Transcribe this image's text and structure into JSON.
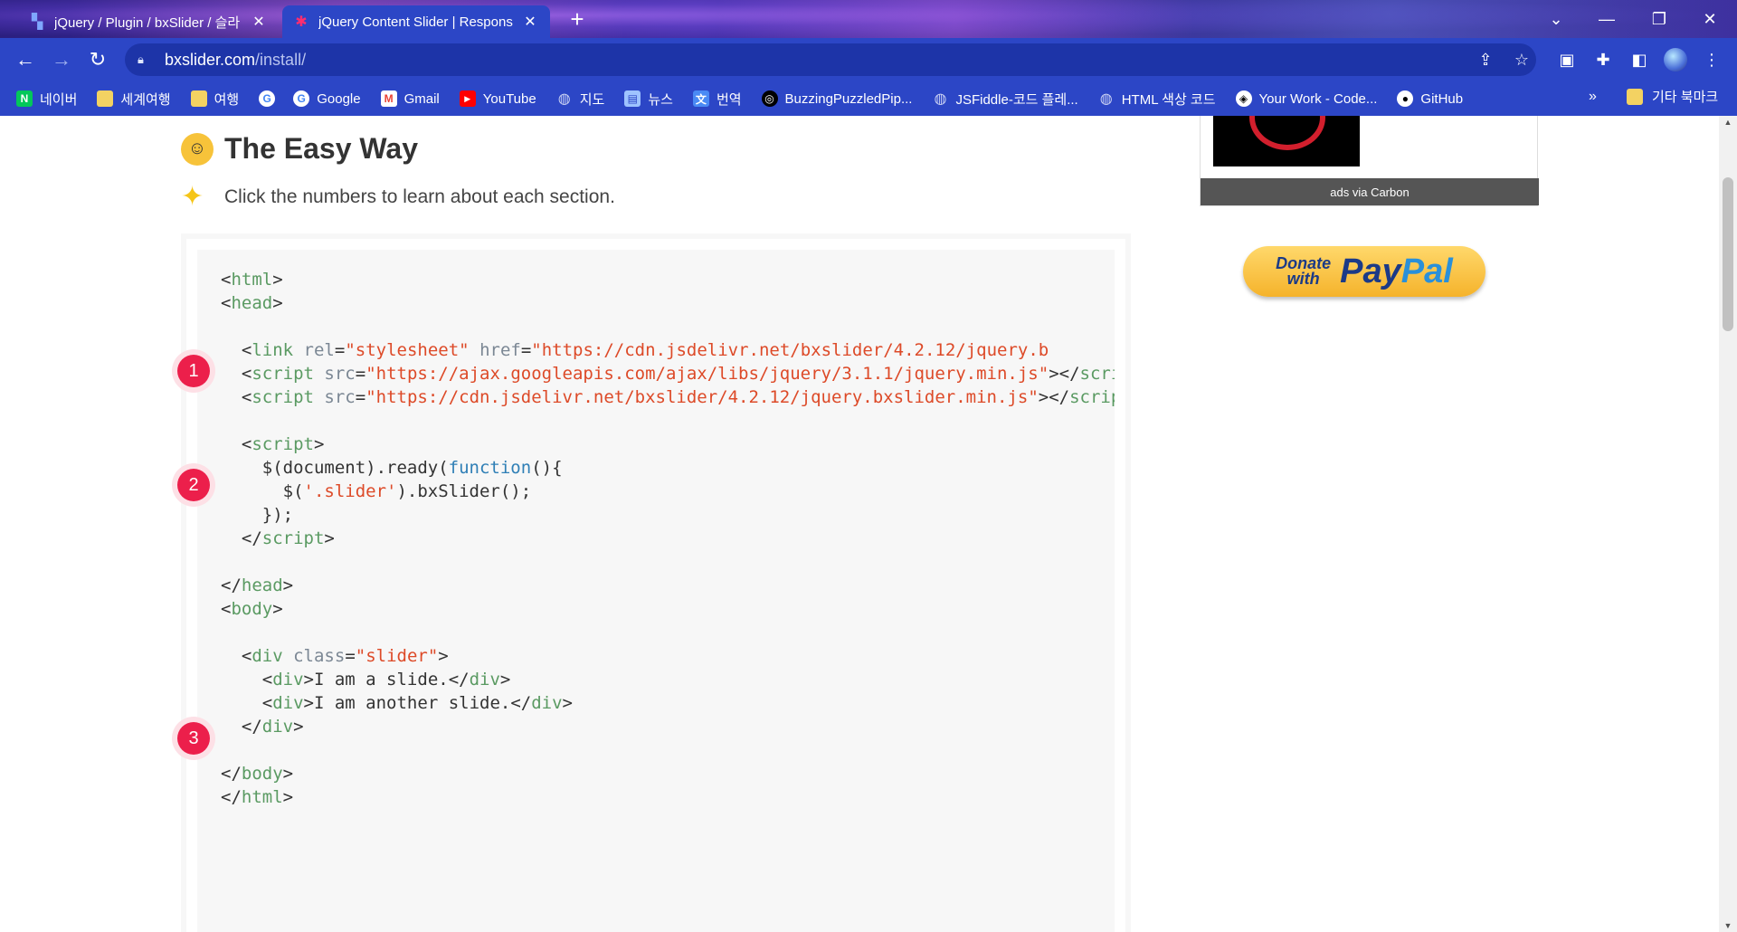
{
  "browser": {
    "tabs": [
      {
        "title": "jQuery / Plugin / bxSlider / 슬라",
        "active": false
      },
      {
        "title": "jQuery Content Slider | Respons",
        "active": true
      }
    ],
    "new_tab": "+",
    "url_host": "bxslider.com",
    "url_path": "/install/",
    "bookmarks": [
      {
        "label": "네이버",
        "icon": "naver-icon"
      },
      {
        "label": "세계여행",
        "icon": "folder-icon"
      },
      {
        "label": "여행",
        "icon": "folder-icon"
      },
      {
        "label": "",
        "icon": "google-icon"
      },
      {
        "label": "Google",
        "icon": "google-icon"
      },
      {
        "label": "Gmail",
        "icon": "gmail-icon"
      },
      {
        "label": "YouTube",
        "icon": "youtube-icon"
      },
      {
        "label": "지도",
        "icon": "globe-icon"
      },
      {
        "label": "뉴스",
        "icon": "news-icon"
      },
      {
        "label": "번역",
        "icon": "translate-icon"
      },
      {
        "label": "BuzzingPuzzledPip...",
        "icon": "replit-icon"
      },
      {
        "label": "JSFiddle-코드 플레...",
        "icon": "globe-icon"
      },
      {
        "label": "HTML 색상 코드",
        "icon": "globe-icon"
      },
      {
        "label": "Your Work - Code...",
        "icon": "codepen-icon"
      },
      {
        "label": "GitHub",
        "icon": "github-icon"
      }
    ],
    "bookmarks_more": "»",
    "other_bookmarks": "기타 북마크"
  },
  "page": {
    "heading": "The Easy Way",
    "subtitle": "Click the numbers to learn about each section.",
    "ad_caption": "ads via Carbon",
    "paypal": {
      "donate": "Donate",
      "with": "with",
      "brand1": "Pay",
      "brand2": "Pal"
    },
    "markers": [
      "1",
      "2",
      "3"
    ],
    "code": {
      "line_html_open": "html",
      "line_head_open": "head",
      "link_url": "https://cdn.jsdelivr.net/bxslider/4.2.12/jquery.b",
      "script1_url": "https://ajax.googleapis.com/ajax/libs/jquery/3.1.1/jquery.min.js",
      "script2_url": "https://cdn.jsdelivr.net/bxslider/4.2.12/jquery.bxslider.min.js",
      "selector": "'.slider'",
      "slide1": "I am a slide.",
      "slide2": "I am another slide.",
      "class_value": "\"slider\""
    }
  },
  "colors": {
    "chrome": "#2c46c6",
    "marker": "#ec1f4b",
    "tag": "#5a9a62",
    "string": "#dd4a28",
    "keyword": "#2f7fb6"
  }
}
